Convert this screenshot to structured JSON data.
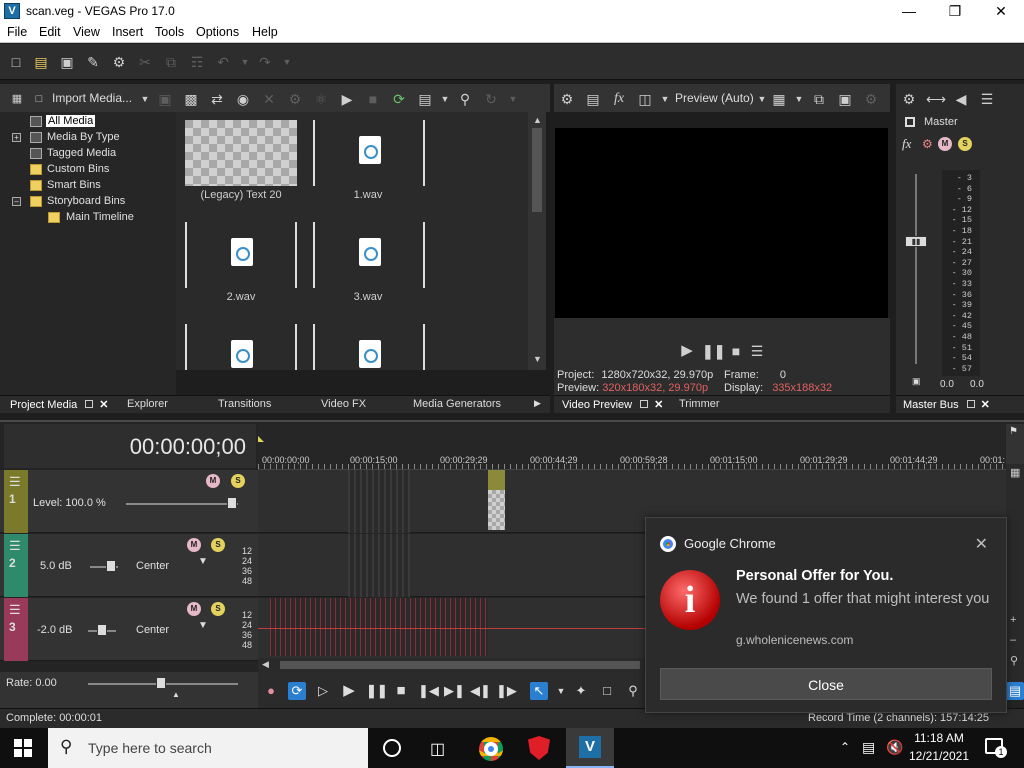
{
  "window": {
    "title": "scan.veg - VEGAS Pro 17.0",
    "icon_letter": "V"
  },
  "menu": [
    "File",
    "Edit",
    "View",
    "Insert",
    "Tools",
    "Options",
    "Help"
  ],
  "project_media": {
    "import_label": "Import Media...",
    "tree": [
      {
        "label": "All Media",
        "selected": true
      },
      {
        "label": "Media By Type"
      },
      {
        "label": "Tagged Media"
      },
      {
        "label": "Custom Bins"
      },
      {
        "label": "Smart Bins"
      },
      {
        "label": "Storyboard Bins"
      },
      {
        "label": "Main Timeline"
      }
    ],
    "items": [
      "(Legacy) Text 20",
      "1.wav",
      "2.wav",
      "3.wav"
    ]
  },
  "left_tabs": [
    "Project Media",
    "Explorer",
    "Transitions",
    "Video FX",
    "Media Generators"
  ],
  "preview": {
    "quality_label": "Preview (Auto)",
    "project_label": "Project:",
    "project_value": "1280x720x32, 29.970p",
    "frame_label": "Frame:",
    "frame_value": "0",
    "preview_label": "Preview:",
    "preview_value": "320x180x32, 29.970p",
    "display_label": "Display:",
    "display_value": "335x188x32",
    "tabs": [
      "Video Preview",
      "Trimmer"
    ]
  },
  "master": {
    "label": "Master",
    "ticks": [
      "3",
      "6",
      "9",
      "12",
      "15",
      "18",
      "21",
      "24",
      "27",
      "30",
      "33",
      "36",
      "39",
      "42",
      "45",
      "48",
      "51",
      "54",
      "57"
    ],
    "left_value": "0.0",
    "right_value": "0.0",
    "tab": "Master Bus"
  },
  "timeline": {
    "timecode": "00:00:00;00",
    "ruler": [
      "00:00:00;00",
      "00:00:15;00",
      "00:00:29;29",
      "00:00:44;29",
      "00:00:59;28",
      "00:01:15;00",
      "00:01:29;29",
      "00:01:44;29",
      "00:01:"
    ],
    "tracks": [
      {
        "num": "1",
        "label": "Level: 100.0 %",
        "color": "#7a7a2a"
      },
      {
        "num": "2",
        "label": "5.0 dB",
        "pan": "Center",
        "color": "#2e8a6a"
      },
      {
        "num": "3",
        "label": "-2.0 dB",
        "pan": "Center",
        "color": "#9a3a5a"
      }
    ],
    "meter_ticks": [
      "12",
      "24",
      "36",
      "48"
    ],
    "rate": "Rate: 0.00"
  },
  "status": {
    "left": "Complete: 00:00:01",
    "right": "Record Time (2 channels): 157:14:25"
  },
  "toast": {
    "app": "Google Chrome",
    "title": "Personal Offer for You.",
    "body": "We found 1 offer that might interest you",
    "source": "g.wholenicenews.com",
    "button": "Close"
  },
  "taskbar": {
    "search_placeholder": "Type here to search",
    "time": "11:18 AM",
    "date": "12/21/2021",
    "notif_count": "1"
  }
}
